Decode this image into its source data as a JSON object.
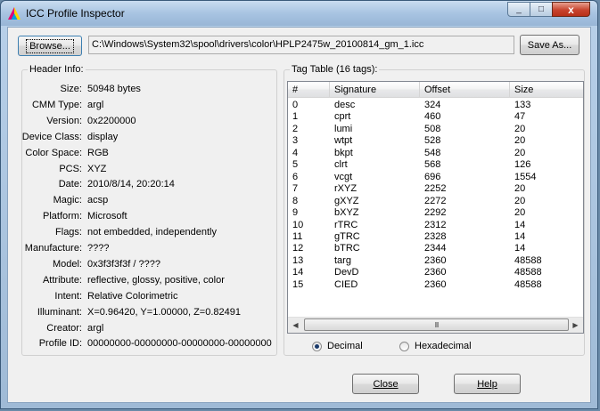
{
  "window": {
    "title": "ICC Profile Inspector",
    "minimize": "_",
    "maximize": "□",
    "close": "x"
  },
  "toolbar": {
    "browse_label": "Browse...",
    "path_value": "C:\\Windows\\System32\\spool\\drivers\\color\\HPLP2475w_20100814_gm_1.icc",
    "saveas_label": "Save As..."
  },
  "header": {
    "title": "Header Info:",
    "fields": [
      {
        "label": "Size:",
        "value": "50948 bytes"
      },
      {
        "label": "CMM Type:",
        "value": "argl"
      },
      {
        "label": "Version:",
        "value": "0x2200000"
      },
      {
        "label": "Device Class:",
        "value": "display"
      },
      {
        "label": "Color Space:",
        "value": "RGB"
      },
      {
        "label": "PCS:",
        "value": "XYZ"
      },
      {
        "label": "Date:",
        "value": "2010/8/14, 20:20:14"
      },
      {
        "label": "Magic:",
        "value": "acsp"
      },
      {
        "label": "Platform:",
        "value": "Microsoft"
      },
      {
        "label": "Flags:",
        "value": "not embedded, independently"
      },
      {
        "label": "Manufacture:",
        "value": "????"
      },
      {
        "label": "Model:",
        "value": "0x3f3f3f3f / ????"
      },
      {
        "label": "Attribute:",
        "value": "reflective, glossy, positive, color"
      },
      {
        "label": "Intent:",
        "value": "Relative Colorimetric"
      },
      {
        "label": "Illuminant:",
        "value": "X=0.96420, Y=1.00000, Z=0.82491"
      },
      {
        "label": "Creator:",
        "value": "argl"
      },
      {
        "label": "Profile ID:",
        "value": "00000000-00000000-00000000-00000000"
      }
    ]
  },
  "tags": {
    "title": "Tag Table (16 tags):",
    "columns": [
      "#",
      "Signature",
      "Offset",
      "Size"
    ],
    "rows": [
      [
        "0",
        "desc",
        "324",
        "133"
      ],
      [
        "1",
        "cprt",
        "460",
        "47"
      ],
      [
        "2",
        "lumi",
        "508",
        "20"
      ],
      [
        "3",
        "wtpt",
        "528",
        "20"
      ],
      [
        "4",
        "bkpt",
        "548",
        "20"
      ],
      [
        "5",
        "clrt",
        "568",
        "126"
      ],
      [
        "6",
        "vcgt",
        "696",
        "1554"
      ],
      [
        "7",
        "rXYZ",
        "2252",
        "20"
      ],
      [
        "8",
        "gXYZ",
        "2272",
        "20"
      ],
      [
        "9",
        "bXYZ",
        "2292",
        "20"
      ],
      [
        "10",
        "rTRC",
        "2312",
        "14"
      ],
      [
        "11",
        "gTRC",
        "2328",
        "14"
      ],
      [
        "12",
        "bTRC",
        "2344",
        "14"
      ],
      [
        "13",
        "targ",
        "2360",
        "48588"
      ],
      [
        "14",
        "DevD",
        "2360",
        "48588"
      ],
      [
        "15",
        "CIED",
        "2360",
        "48588"
      ]
    ],
    "scroll_thumb_grip": "III",
    "radix": {
      "decimal": "Decimal",
      "hexadecimal": "Hexadecimal",
      "selected": "decimal"
    }
  },
  "footer": {
    "close_label": "Close",
    "help_label": "Help"
  }
}
